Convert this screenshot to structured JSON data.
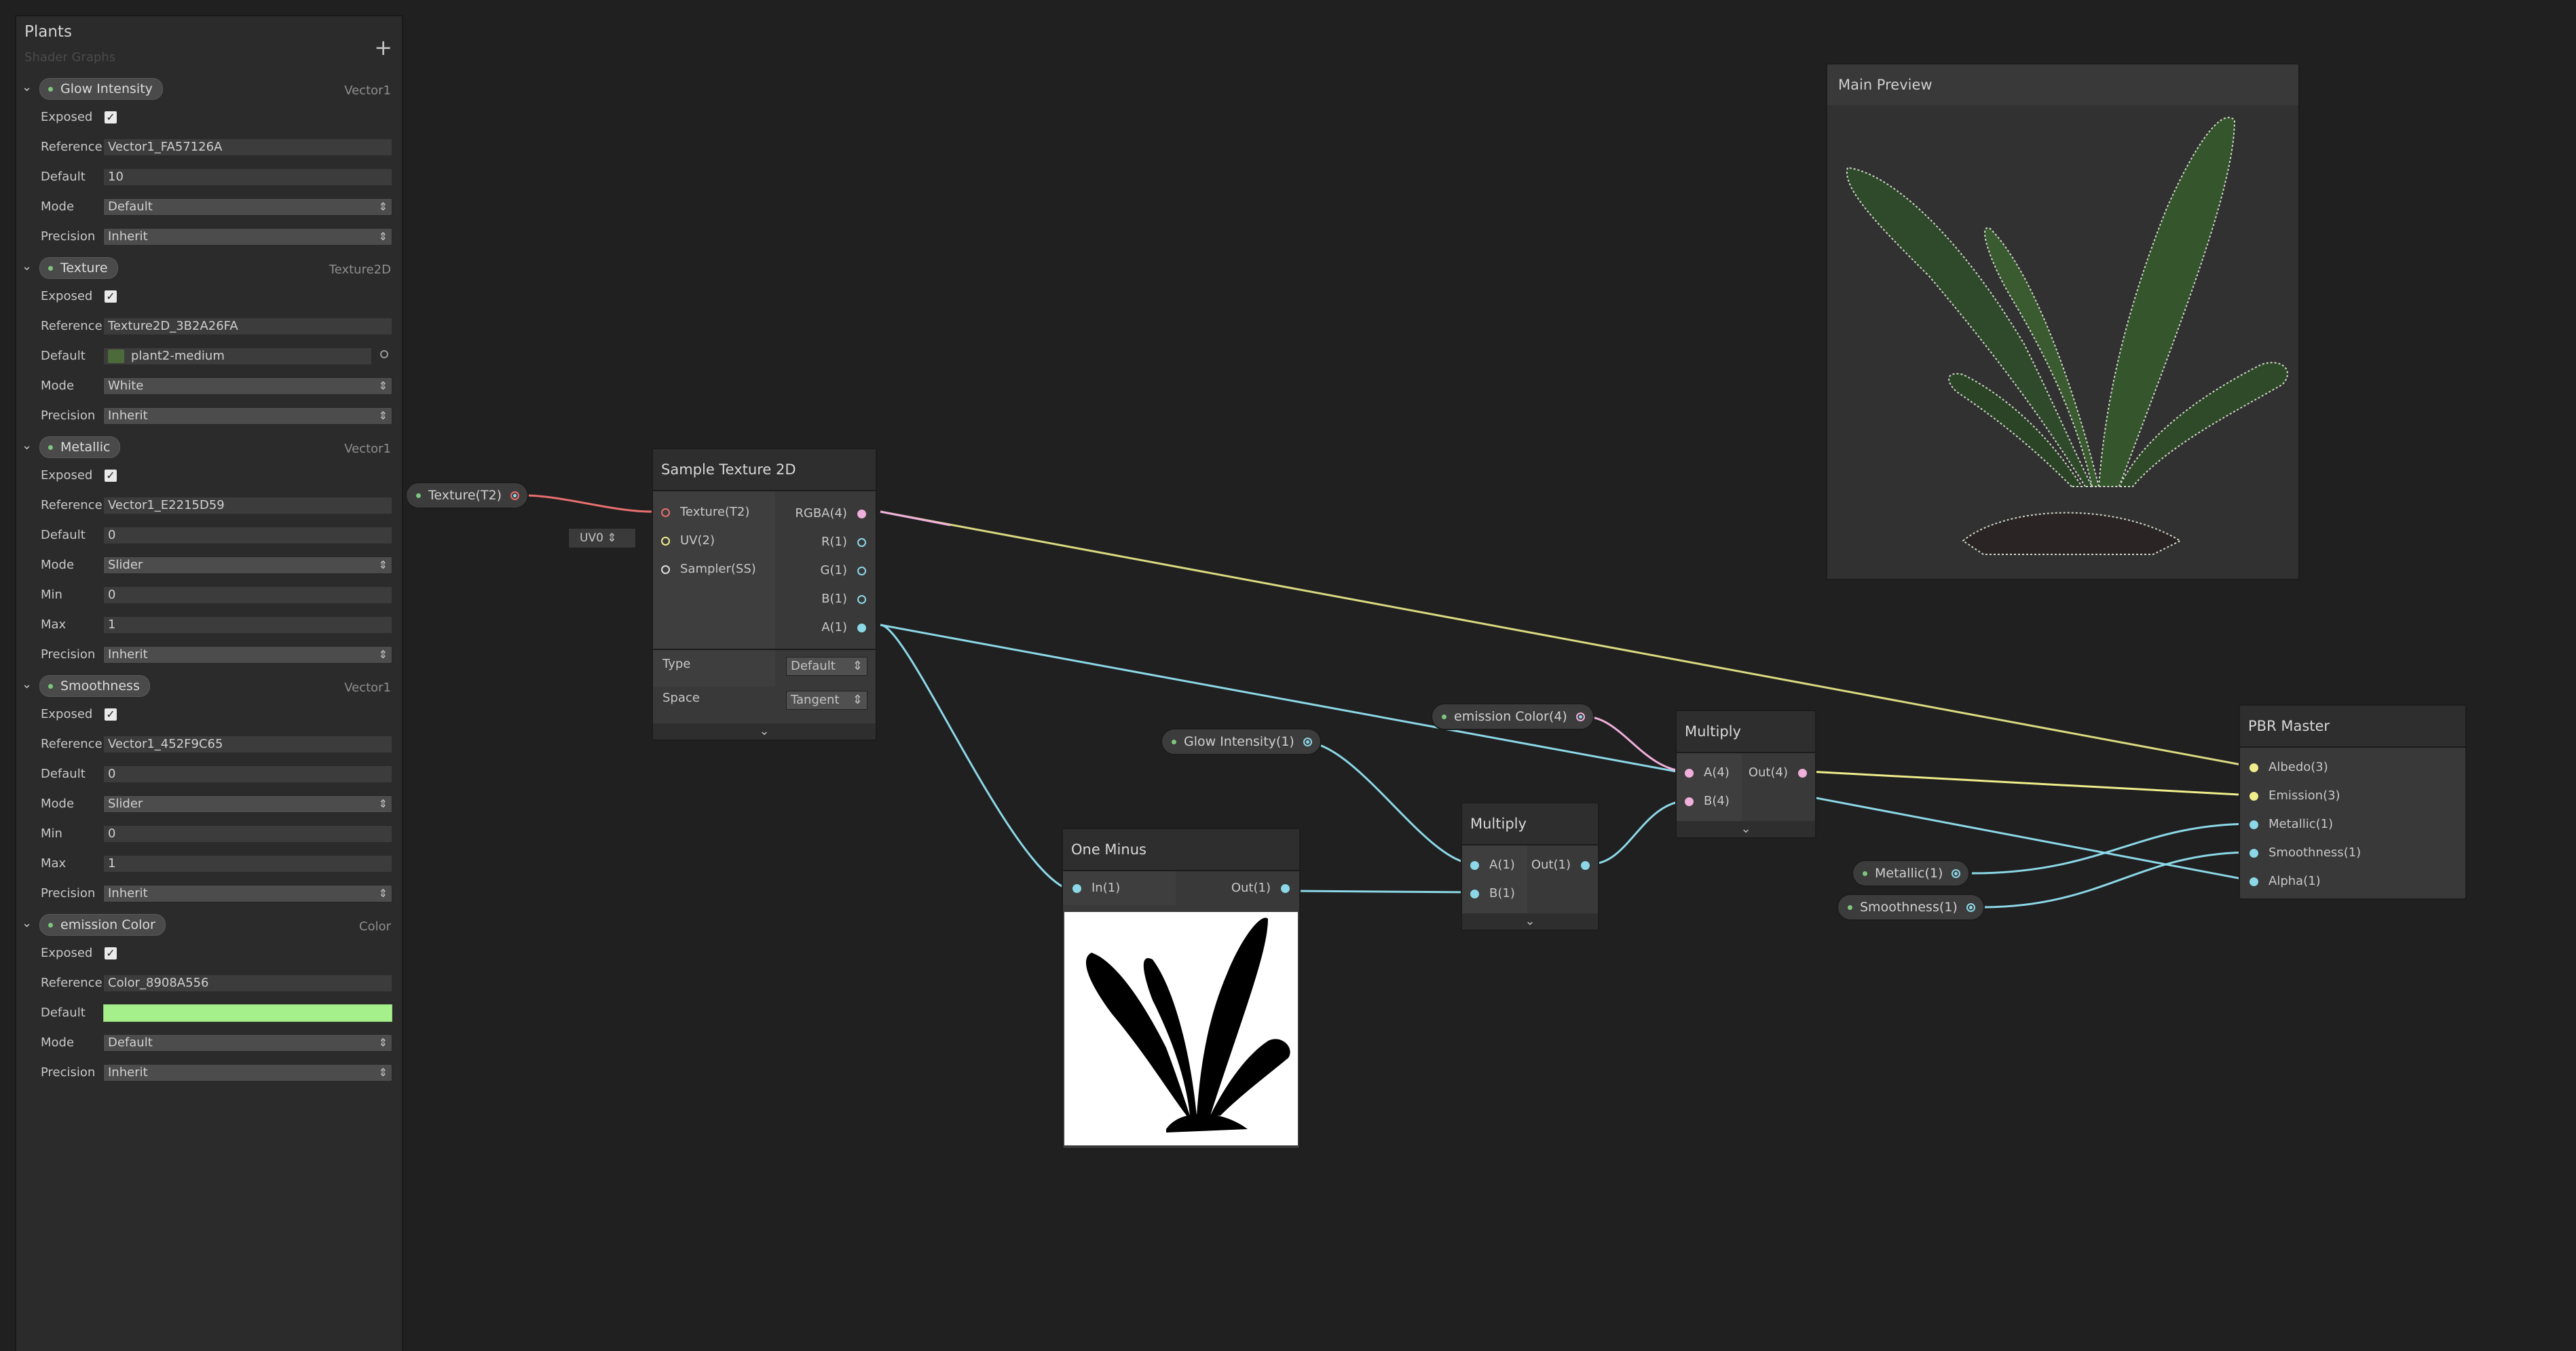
{
  "blackboard": {
    "title": "Plants",
    "subtitle": "Shader Graphs",
    "add_label": "+",
    "properties": [
      {
        "name": "Glow Intensity",
        "type": "Vector1",
        "rows": [
          {
            "label": "Exposed",
            "kind": "check",
            "value": "✓"
          },
          {
            "label": "Reference",
            "kind": "text",
            "value": "Vector1_FA57126A"
          },
          {
            "label": "Default",
            "kind": "text",
            "value": "10"
          },
          {
            "label": "Mode",
            "kind": "dropdown",
            "value": "Default"
          },
          {
            "label": "Precision",
            "kind": "dropdown",
            "value": "Inherit"
          }
        ]
      },
      {
        "name": "Texture",
        "type": "Texture2D",
        "rows": [
          {
            "label": "Exposed",
            "kind": "check",
            "value": "✓"
          },
          {
            "label": "Reference",
            "kind": "text",
            "value": "Texture2D_3B2A26FA"
          },
          {
            "label": "Default",
            "kind": "texture",
            "value": "plant2-medium"
          },
          {
            "label": "Mode",
            "kind": "dropdown",
            "value": "White"
          },
          {
            "label": "Precision",
            "kind": "dropdown",
            "value": "Inherit"
          }
        ]
      },
      {
        "name": "Metallic",
        "type": "Vector1",
        "rows": [
          {
            "label": "Exposed",
            "kind": "check",
            "value": "✓"
          },
          {
            "label": "Reference",
            "kind": "text",
            "value": "Vector1_E2215D59"
          },
          {
            "label": "Default",
            "kind": "text",
            "value": "0"
          },
          {
            "label": "Mode",
            "kind": "dropdown",
            "value": "Slider"
          },
          {
            "label": "Min",
            "kind": "text",
            "value": "0"
          },
          {
            "label": "Max",
            "kind": "text",
            "value": "1"
          },
          {
            "label": "Precision",
            "kind": "dropdown",
            "value": "Inherit"
          }
        ]
      },
      {
        "name": "Smoothness",
        "type": "Vector1",
        "rows": [
          {
            "label": "Exposed",
            "kind": "check",
            "value": "✓"
          },
          {
            "label": "Reference",
            "kind": "text",
            "value": "Vector1_452F9C65"
          },
          {
            "label": "Default",
            "kind": "text",
            "value": "0"
          },
          {
            "label": "Mode",
            "kind": "dropdown",
            "value": "Slider"
          },
          {
            "label": "Min",
            "kind": "text",
            "value": "0"
          },
          {
            "label": "Max",
            "kind": "text",
            "value": "1"
          },
          {
            "label": "Precision",
            "kind": "dropdown",
            "value": "Inherit"
          }
        ]
      },
      {
        "name": "emission Color",
        "type": "Color",
        "rows": [
          {
            "label": "Exposed",
            "kind": "check",
            "value": "✓"
          },
          {
            "label": "Reference",
            "kind": "text",
            "value": "Color_8908A556"
          },
          {
            "label": "Default",
            "kind": "color",
            "value": "#a6f08c"
          },
          {
            "label": "Mode",
            "kind": "dropdown",
            "value": "Default"
          },
          {
            "label": "Precision",
            "kind": "dropdown",
            "value": "Inherit"
          }
        ]
      }
    ]
  },
  "graph": {
    "property_nodes": {
      "texture": "Texture(T2)",
      "uv": "UV0",
      "glow": "Glow Intensity(1)",
      "emission": "emission Color(4)",
      "metallic": "Metallic(1)",
      "smoothness": "Smoothness(1)"
    },
    "sample_texture": {
      "title": "Sample Texture 2D",
      "inputs": [
        "Texture(T2)",
        "UV(2)",
        "Sampler(SS)"
      ],
      "outputs": [
        "RGBA(4)",
        "R(1)",
        "G(1)",
        "B(1)",
        "A(1)"
      ],
      "type_label": "Type",
      "type_value": "Default",
      "space_label": "Space",
      "space_value": "Tangent"
    },
    "one_minus": {
      "title": "One Minus",
      "input": "In(1)",
      "output": "Out(1)"
    },
    "multiply1": {
      "title": "Multiply",
      "inputs": [
        "A(1)",
        "B(1)"
      ],
      "output": "Out(1)"
    },
    "multiply2": {
      "title": "Multiply",
      "inputs": [
        "A(4)",
        "B(4)"
      ],
      "output": "Out(4)"
    },
    "pbr": {
      "title": "PBR Master",
      "inputs": [
        "Albedo(3)",
        "Emission(3)",
        "Metallic(1)",
        "Smoothness(1)",
        "Alpha(1)"
      ]
    },
    "preview": {
      "title": "Main Preview"
    },
    "footer_chevron": "⌄",
    "colors": {
      "texture_wire": "#e8706e",
      "vec4_wire": "#f0b0dc",
      "vec3_wire": "#f0ee8c",
      "vec1_wire": "#8cd8e8",
      "emission_color": "#a6f08c"
    }
  }
}
